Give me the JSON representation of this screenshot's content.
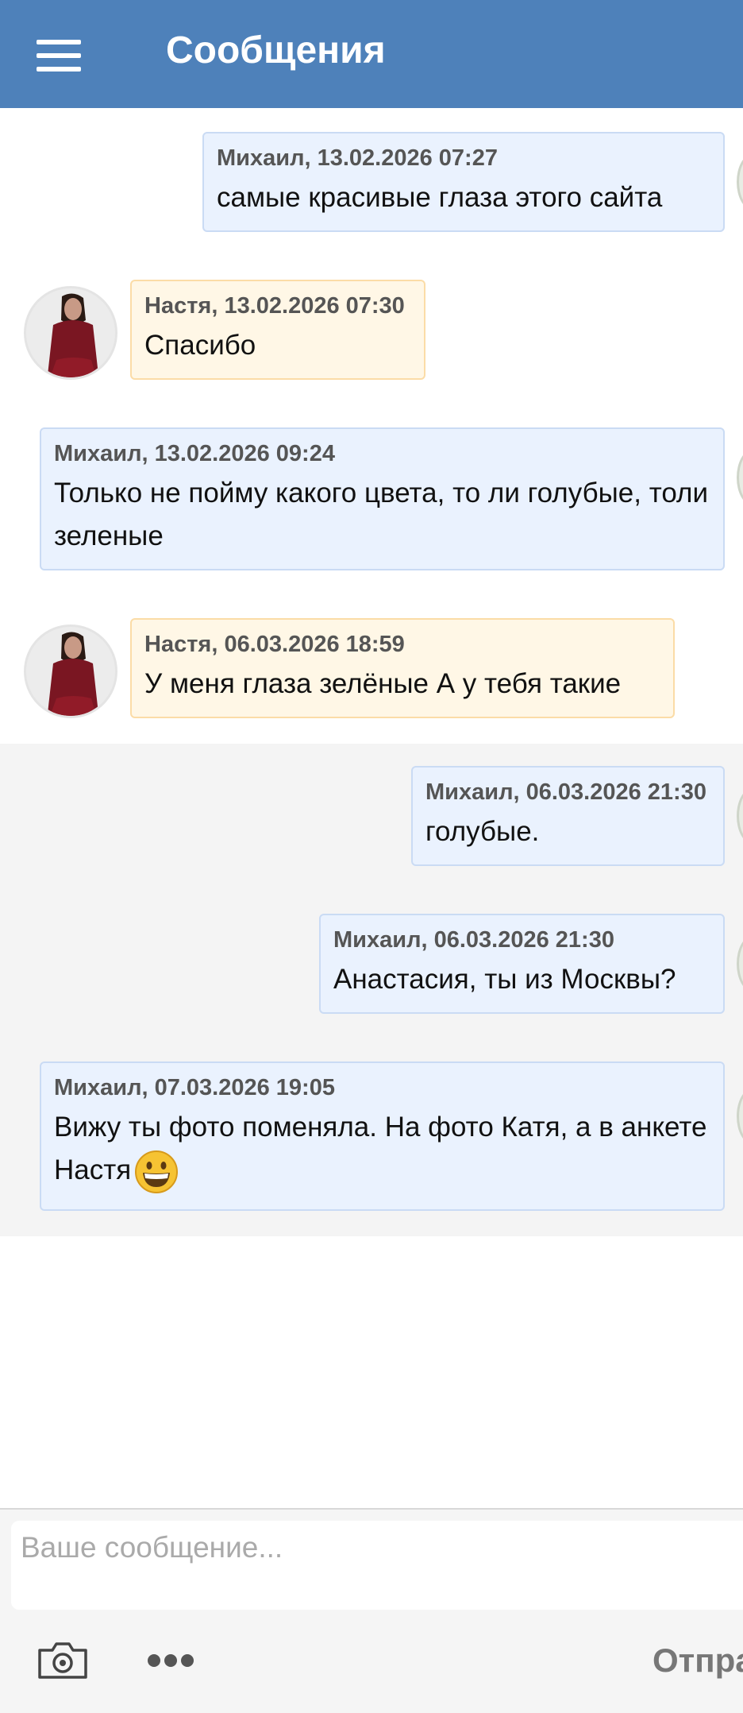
{
  "header": {
    "title": "Сообщения",
    "menu_icon": "hamburger-menu-icon"
  },
  "messages": [
    {
      "author": "Михаил",
      "meta": "Михаил, 13.02.2026 07:27",
      "text": "самые красивые глаза этого сайта"
    },
    {
      "author": "Настя",
      "meta": "Настя, 13.02.2026 07:30",
      "text": "Спасибо"
    },
    {
      "author": "Михаил",
      "meta": "Михаил, 13.02.2026 09:24",
      "text": "Только не пойму какого цвета, то ли голубые, толи зеленые"
    },
    {
      "author": "Настя",
      "meta": "Настя, 06.03.2026 18:59",
      "text": "У меня глаза зелёные А у тебя такие"
    },
    {
      "author": "Михаил",
      "meta": "Михаил, 06.03.2026 21:30",
      "text": "голубые."
    },
    {
      "author": "Михаил",
      "meta": "Михаил, 06.03.2026 21:30",
      "text": "Анастасия, ты из Москвы?"
    },
    {
      "author": "Михаил",
      "meta": "Михаил, 07.03.2026 19:05",
      "text": "Вижу ты фото поменяла. На фото Катя, а в анкете Настя",
      "emoji": "grinning-face-emoji"
    }
  ],
  "composer": {
    "placeholder": "Ваше сообщение...",
    "send_label": "Отпра",
    "camera_icon": "camera-icon",
    "more_icon": "more-dots-icon"
  },
  "colors": {
    "header": "#4e81ba",
    "my_bubble_bg": "#eaf2fe",
    "my_bubble_border": "#cadbf4",
    "her_bubble_bg": "#fff7e6",
    "her_bubble_border": "#fbdca7"
  }
}
